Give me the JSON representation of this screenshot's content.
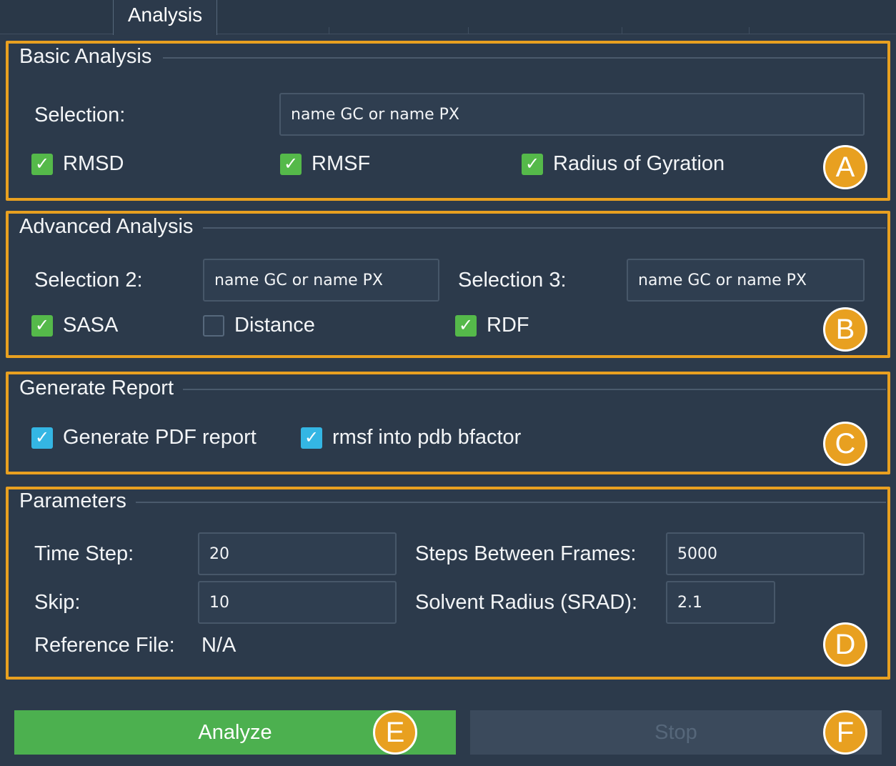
{
  "tabs": {
    "active": "Analysis"
  },
  "basic": {
    "title": "Basic Analysis",
    "selection_label": "Selection:",
    "selection_value": "name GC or name PX",
    "checks": [
      {
        "label": "RMSD",
        "checked": true
      },
      {
        "label": "RMSF",
        "checked": true
      },
      {
        "label": "Radius of Gyration",
        "checked": true
      }
    ],
    "badge": "A"
  },
  "advanced": {
    "title": "Advanced Analysis",
    "selection2_label": "Selection 2:",
    "selection2_value": "name GC or name PX",
    "selection3_label": "Selection 3:",
    "selection3_value": "name GC or name PX",
    "checks": [
      {
        "label": "SASA",
        "checked": true
      },
      {
        "label": "Distance",
        "checked": false
      },
      {
        "label": "RDF",
        "checked": true
      }
    ],
    "badge": "B"
  },
  "report": {
    "title": "Generate Report",
    "checks": [
      {
        "label": "Generate PDF report",
        "checked": true
      },
      {
        "label": "rmsf into pdb bfactor",
        "checked": true
      }
    ],
    "badge": "C"
  },
  "parameters": {
    "title": "Parameters",
    "time_step_label": "Time Step:",
    "time_step_value": "20",
    "steps_between_label": "Steps Between Frames:",
    "steps_between_value": "5000",
    "skip_label": "Skip:",
    "skip_value": "10",
    "srad_label": "Solvent Radius (SRAD):",
    "srad_value": "2.1",
    "ref_label": "Reference File:",
    "ref_value": "N/A",
    "badge": "D"
  },
  "actions": {
    "analyze_label": "Analyze",
    "analyze_badge": "E",
    "stop_label": "Stop",
    "stop_badge": "F"
  },
  "colors": {
    "background": "#2c3a4b",
    "highlight_border": "#e8a020",
    "checkbox_green": "#55b94a",
    "checkbox_blue": "#34b6e4",
    "analyze_green": "#4cb04f",
    "stop_disabled": "#3b4a5c"
  },
  "icons": {
    "check": "checkmark-icon"
  }
}
